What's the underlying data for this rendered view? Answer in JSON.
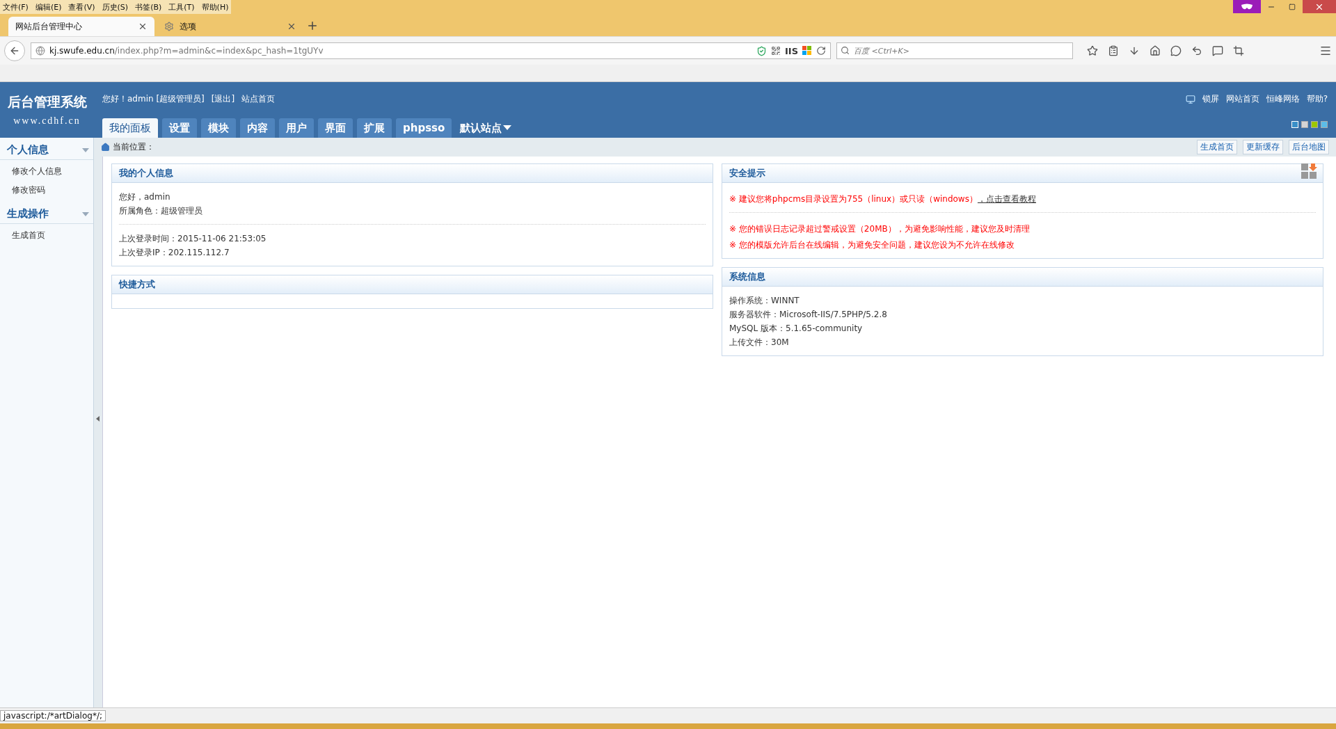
{
  "browser": {
    "menu": [
      "文件(F)",
      "编辑(E)",
      "查看(V)",
      "历史(S)",
      "书签(B)",
      "工具(T)",
      "帮助(H)"
    ],
    "tabs": [
      {
        "label": "网站后台管理中心",
        "selected": true,
        "kind": "page"
      },
      {
        "label": "选项",
        "selected": false,
        "kind": "settings"
      }
    ],
    "url": {
      "host": "kj.swufe.edu.cn",
      "path": "/index.php?m=admin&c=index&pc_hash=1tgUYv"
    },
    "badge": "IIS",
    "search": {
      "placeholder": "百度 <Ctrl+K>"
    },
    "status": "javascript:/*artDialog*/;"
  },
  "header": {
    "logo": "后台管理系统",
    "logo_sub": "www.cdhf.cn",
    "user_links": [
      "您好！admin [超级管理员]",
      "[退出]",
      "站点首页"
    ],
    "nav": [
      {
        "label": "我的面板",
        "selected": true
      },
      {
        "label": "设置",
        "selected": false
      },
      {
        "label": "模块",
        "selected": false
      },
      {
        "label": "内容",
        "selected": false
      },
      {
        "label": "用户",
        "selected": false
      },
      {
        "label": "界面",
        "selected": false
      },
      {
        "label": "扩展",
        "selected": false
      },
      {
        "label": "phpsso",
        "selected": false
      }
    ],
    "site_menu": "默认站点",
    "right_links": [
      "锁屏",
      "网站首页",
      "恒峰网络",
      "帮助?"
    ],
    "themes": [
      {
        "color": "#3a8fc8",
        "selected": true
      },
      {
        "color": "#d4d4d4",
        "selected": false
      },
      {
        "color": "#9cc800",
        "selected": false
      },
      {
        "color": "#5cbde8",
        "selected": false
      }
    ]
  },
  "sidebar": [
    {
      "title": "个人信息",
      "items": [
        "修改个人信息",
        "修改密码"
      ]
    },
    {
      "title": "生成操作",
      "items": [
        "生成首页"
      ]
    }
  ],
  "breadcrumb": "当前位置：",
  "actions": [
    "生成首页",
    "更新缓存",
    "后台地图"
  ],
  "panels_left": [
    {
      "title": "我的个人信息",
      "groups": [
        [
          "您好，admin",
          "所属角色：超级管理员"
        ],
        [
          "上次登录时间：2015-11-06 21:53:05",
          "上次登录IP：202.115.112.7"
        ]
      ]
    },
    {
      "title": "快捷方式"
    }
  ],
  "security": {
    "title": "安全提示",
    "groups": [
      [
        {
          "text": "※ 建议您将phpcms目录设置为755（linux）或只读（windows）",
          "link": "，点击查看教程"
        }
      ],
      [
        {
          "text": "※ 您的错误日志记录超过警戒设置（20MB），为避免影响性能，建议您及时清理"
        },
        {
          "text": "※ 您的模版允许后台在线编辑，为避免安全问题，建议您设为不允许在线修改"
        }
      ]
    ]
  },
  "system": {
    "title": "系统信息",
    "lines": [
      "操作系统：WINNT",
      "服务器软件：Microsoft-IIS/7.5PHP/5.2.8",
      "MySQL 版本：5.1.65-community",
      "上传文件：30M"
    ]
  }
}
